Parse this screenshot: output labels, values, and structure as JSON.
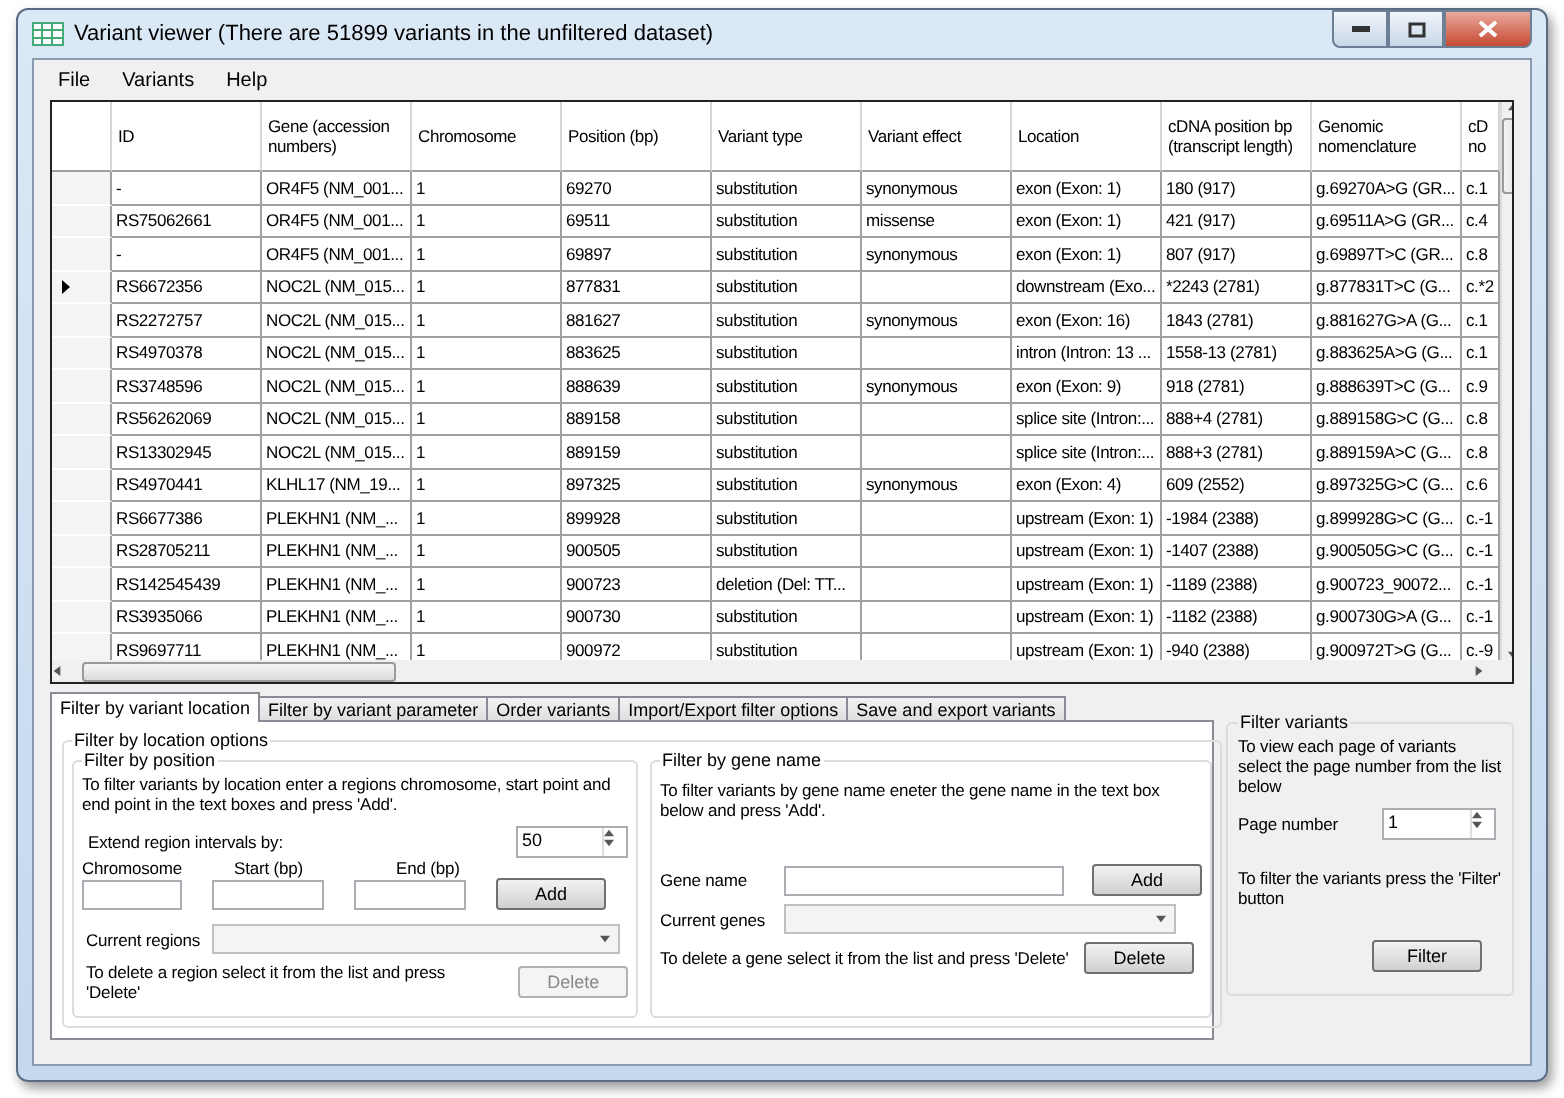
{
  "window": {
    "title": "Variant viewer (There are 51899 variants in the unfiltered dataset)"
  },
  "menu": [
    "File",
    "Variants",
    "Help"
  ],
  "table": {
    "columns": [
      "ID",
      "Gene (accession numbers)",
      "Chromosome",
      "Position (bp)",
      "Variant type",
      "Variant effect",
      "Location",
      "cDNA position bp (transcript length)",
      "Genomic nomenclature",
      "cD no"
    ],
    "rows": [
      {
        "current": false,
        "cells": [
          "-",
          "OR4F5 (NM_001...",
          "1",
          "69270",
          "substitution",
          "synonymous",
          "exon (Exon: 1)",
          "180 (917)",
          "g.69270A>G (GR...",
          "c.1"
        ]
      },
      {
        "current": false,
        "cells": [
          "RS75062661",
          "OR4F5 (NM_001...",
          "1",
          "69511",
          "substitution",
          "missense",
          "exon (Exon: 1)",
          "421 (917)",
          "g.69511A>G (GR...",
          "c.4"
        ]
      },
      {
        "current": false,
        "cells": [
          "-",
          "OR4F5 (NM_001...",
          "1",
          "69897",
          "substitution",
          "synonymous",
          "exon (Exon: 1)",
          "807 (917)",
          "g.69897T>C (GR...",
          "c.8"
        ]
      },
      {
        "current": true,
        "cells": [
          "RS6672356",
          "NOC2L (NM_015...",
          "1",
          "877831",
          "substitution",
          "",
          "downstream (Exo...",
          "*2243 (2781)",
          "g.877831T>C (G...",
          "c.*2"
        ]
      },
      {
        "current": false,
        "cells": [
          "RS2272757",
          "NOC2L (NM_015...",
          "1",
          "881627",
          "substitution",
          "synonymous",
          "exon (Exon: 16)",
          "1843 (2781)",
          "g.881627G>A (G...",
          "c.1"
        ]
      },
      {
        "current": false,
        "cells": [
          "RS4970378",
          "NOC2L (NM_015...",
          "1",
          "883625",
          "substitution",
          "",
          "intron (Intron: 13 ...",
          "1558-13 (2781)",
          "g.883625A>G (G...",
          "c.1"
        ]
      },
      {
        "current": false,
        "cells": [
          "RS3748596",
          "NOC2L (NM_015...",
          "1",
          "888639",
          "substitution",
          "synonymous",
          "exon (Exon: 9)",
          "918 (2781)",
          "g.888639T>C (G...",
          "c.9"
        ]
      },
      {
        "current": false,
        "cells": [
          "RS56262069",
          "NOC2L (NM_015...",
          "1",
          "889158",
          "substitution",
          "",
          "splice site (Intron:...",
          "888+4 (2781)",
          "g.889158G>C (G...",
          "c.8"
        ]
      },
      {
        "current": false,
        "cells": [
          "RS13302945",
          "NOC2L (NM_015...",
          "1",
          "889159",
          "substitution",
          "",
          "splice site (Intron:...",
          "888+3 (2781)",
          "g.889159A>C (G...",
          "c.8"
        ]
      },
      {
        "current": false,
        "cells": [
          "RS4970441",
          "KLHL17 (NM_19...",
          "1",
          "897325",
          "substitution",
          "synonymous",
          "exon (Exon: 4)",
          "609 (2552)",
          "g.897325G>C (G...",
          "c.6"
        ]
      },
      {
        "current": false,
        "cells": [
          "RS6677386",
          "PLEKHN1 (NM_...",
          "1",
          "899928",
          "substitution",
          "",
          "upstream (Exon: 1)",
          "-1984 (2388)",
          "g.899928G>C (G...",
          "c.-1"
        ]
      },
      {
        "current": false,
        "cells": [
          "RS28705211",
          "PLEKHN1 (NM_...",
          "1",
          "900505",
          "substitution",
          "",
          "upstream (Exon: 1)",
          "-1407 (2388)",
          "g.900505G>C (G...",
          "c.-1"
        ]
      },
      {
        "current": false,
        "cells": [
          "RS142545439",
          "PLEKHN1 (NM_...",
          "1",
          "900723",
          "deletion (Del: TT...",
          "",
          "upstream (Exon: 1)",
          "-1189 (2388)",
          "g.900723_90072...",
          "c.-1"
        ]
      },
      {
        "current": false,
        "cells": [
          "RS3935066",
          "PLEKHN1 (NM_...",
          "1",
          "900730",
          "substitution",
          "",
          "upstream (Exon: 1)",
          "-1182 (2388)",
          "g.900730G>A (G...",
          "c.-1"
        ]
      },
      {
        "current": false,
        "cells": [
          "RS9697711",
          "PLEKHN1 (NM_...",
          "1",
          "900972",
          "substitution",
          "",
          "upstream (Exon: 1)",
          "-940 (2388)",
          "g.900972T>G (G...",
          "c.-9"
        ]
      }
    ]
  },
  "tabs": [
    {
      "label": "Filter by variant location",
      "selected": true
    },
    {
      "label": "Filter by variant parameter",
      "selected": false
    },
    {
      "label": "Order variants",
      "selected": false
    },
    {
      "label": "Import/Export filter options",
      "selected": false
    },
    {
      "label": "Save and export variants",
      "selected": false
    }
  ],
  "location_options": {
    "title": "Filter by location options",
    "position": {
      "title": "Filter by position",
      "instructions": "To filter variants by location enter a regions chromosome, start point and end point in the text boxes and press 'Add'.",
      "extend_label": "Extend region intervals by:",
      "extend_value": "50",
      "chromosome_label": "Chromosome",
      "start_label": "Start (bp)",
      "end_label": "End (bp)",
      "add_button": "Add",
      "regions_label": "Current regions",
      "delete_hint": "To delete a region select it from the list and press 'Delete'",
      "delete_button": {
        "label": "Delete",
        "disabled": true
      }
    },
    "gene": {
      "title": "Filter by gene name",
      "instructions": "To filter variants by gene name eneter the gene name in the text box below and press 'Add'.",
      "name_label": "Gene name",
      "add_button": "Add",
      "genes_label": "Current genes",
      "delete_hint": "To delete a gene select it from the list and press 'Delete'",
      "delete_button": {
        "label": "Delete",
        "disabled": false
      }
    }
  },
  "filter_variants": {
    "title": "Filter variants",
    "instructions": "To view each page of variants select the page number from the list below",
    "page_label": "Page number",
    "page_value": "1",
    "filter_hint": "To filter the variants press the 'Filter' button",
    "filter_button": "Filter"
  }
}
